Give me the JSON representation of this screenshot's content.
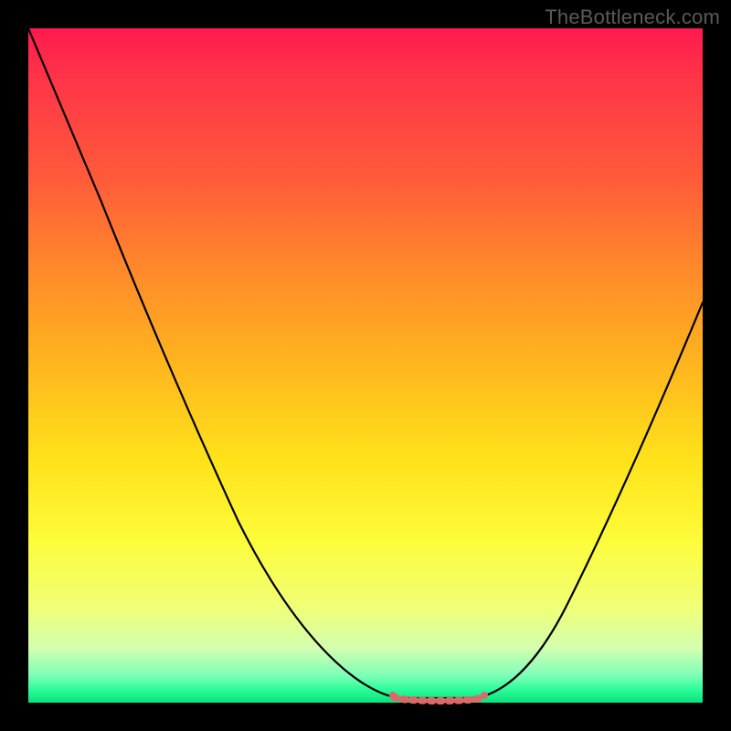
{
  "watermark": "TheBottleneck.com",
  "colors": {
    "frame": "#000000",
    "curve": "#000000",
    "bottom_marker": "#d96a6a",
    "gradient_top": "#ff1a4d",
    "gradient_bottom": "#08e27d"
  },
  "chart_data": {
    "type": "line",
    "title": "",
    "xlabel": "",
    "ylabel": "",
    "xlim": [
      0,
      100
    ],
    "ylim": [
      0,
      100
    ],
    "series": [
      {
        "name": "bottleneck-curve",
        "x": [
          0,
          5,
          10,
          15,
          20,
          25,
          30,
          35,
          40,
          45,
          50,
          54,
          56,
          58,
          60,
          62,
          64,
          66,
          70,
          75,
          80,
          85,
          90,
          95,
          100
        ],
        "values": [
          100,
          91,
          82,
          73,
          64,
          55,
          46,
          37,
          28,
          19,
          10,
          3,
          1,
          0,
          0,
          0,
          0,
          1,
          6,
          14,
          23,
          32,
          41,
          50,
          60
        ]
      }
    ],
    "annotations": [
      {
        "name": "valley-marker",
        "x_range": [
          54,
          66
        ],
        "y": 0,
        "color": "#d96a6a"
      }
    ]
  }
}
